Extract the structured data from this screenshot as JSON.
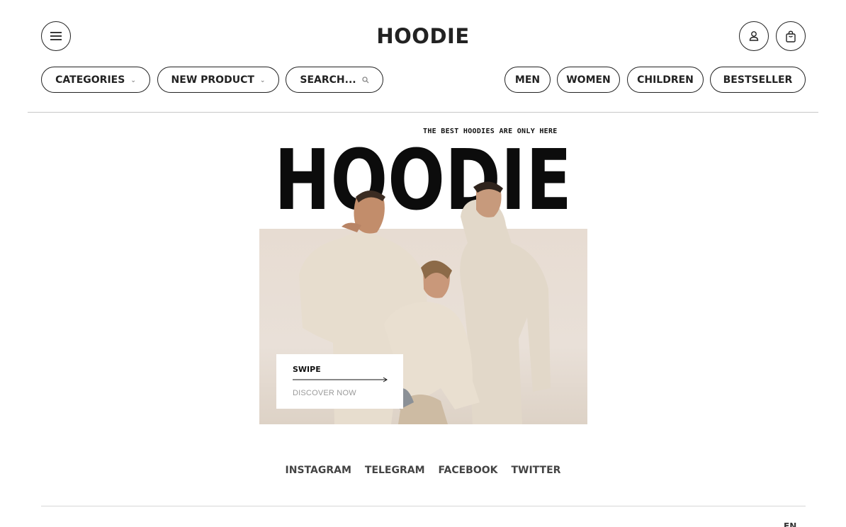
{
  "header": {
    "logo": "HOODIE",
    "menu_icon": "hamburger-menu-icon",
    "user_icon": "user-icon",
    "cart_icon": "shopping-bag-icon"
  },
  "filters": {
    "categories_label": "CATEGORIES",
    "new_product_label": "NEW PRODUCT",
    "search_label": "SEARCH...",
    "chevron_icon": "chevron-down-icon",
    "search_icon": "search-icon"
  },
  "nav": {
    "men": "MEN",
    "women": "WOMEN",
    "children": "CHILDREN",
    "bestseller": "BESTSELLER"
  },
  "hero": {
    "tagline": "THE BEST HOODIES ARE ONLY HERE",
    "big_word": "HOODIE",
    "swipe": "SWIPE",
    "discover": "DISCOVER NOW"
  },
  "socials": [
    "INSTAGRAM",
    "TELEGRAM",
    "FACEBOOK",
    "TWITTER"
  ],
  "footer": {
    "language": "EN"
  },
  "colors": {
    "text": "#222222",
    "photo_bg": "#e7dcd2",
    "hoodie": "#e6dccd",
    "muted": "#9a9a9a"
  }
}
